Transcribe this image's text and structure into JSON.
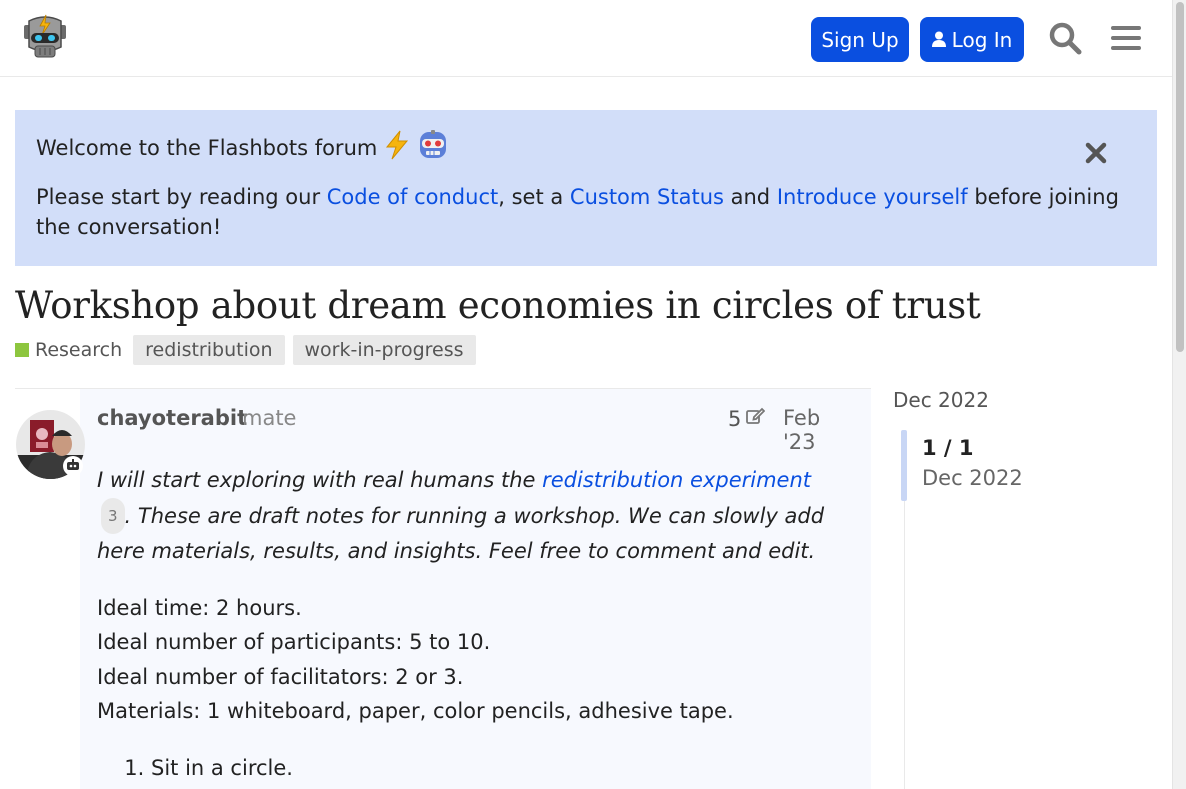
{
  "header": {
    "signup_label": "Sign Up",
    "login_label": "Log In",
    "accent": "#0a4fe0"
  },
  "banner": {
    "title": "Welcome to the Flashbots forum",
    "body_prefix": "Please start by reading our ",
    "link_conduct": "Code of conduct",
    "mid1": ", set a ",
    "link_status": "Custom Status",
    "mid2": " and ",
    "link_intro": "Introduce yourself",
    "body_suffix": " before joining the conversation!",
    "background": "#d2def9"
  },
  "topic": {
    "title": "Workshop about dream economies in circles of trust",
    "category": "Research",
    "category_color": "#8dc63f",
    "tags": [
      "redistribution",
      "work-in-progress"
    ]
  },
  "post": {
    "username": "chayoterabit",
    "user_title": "mate",
    "edit_count": "5",
    "date": "Feb '23",
    "intro_prefix": "I will start exploring with real humans the ",
    "intro_link": "redistribution experiment",
    "link_count": "3",
    "intro_suffix": ". These are draft notes for running a workshop. We can slowly add here materials, results, and insights. Feel free to comment and edit.",
    "details": [
      "Ideal time: 2 hours.",
      "Ideal number of participants: 5 to 10.",
      "Ideal number of facilitators: 2 or 3.",
      "Materials: 1 whiteboard, paper, color pencils, adhesive tape."
    ],
    "steps": [
      "Sit in a circle."
    ]
  },
  "timeline": {
    "top_date": "Dec 2022",
    "count": "1 / 1",
    "current_date": "Dec 2022"
  }
}
